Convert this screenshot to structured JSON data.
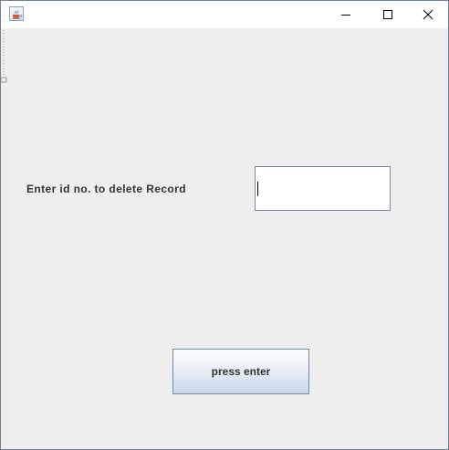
{
  "window": {
    "title": "",
    "icon": "java-coffee-cup-icon",
    "controls": [
      "minimize-icon",
      "maximize-icon",
      "close-icon"
    ]
  },
  "form": {
    "prompt_label": "Enter  id  no.  to  delete  Record",
    "id_input_value": "",
    "id_input_placeholder": ""
  },
  "actions": {
    "submit_label": "press enter"
  },
  "colors": {
    "background": "#eeeeee",
    "titlebar": "#ffffff",
    "text": "#333333",
    "border": "#7a8a9c"
  }
}
